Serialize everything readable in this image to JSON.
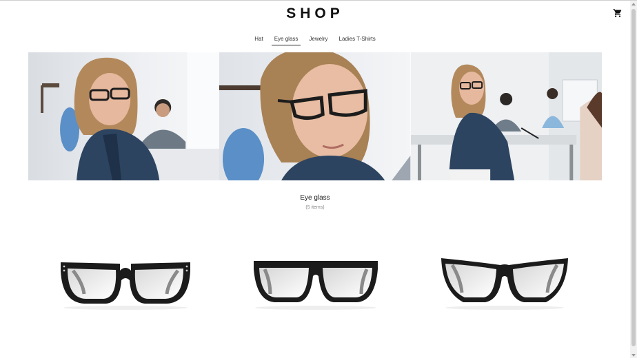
{
  "header": {
    "logo": "SHOP",
    "cart_icon": "shopping-cart-icon"
  },
  "tabs": [
    {
      "label": "Hat",
      "active": false
    },
    {
      "label": "Eye glass",
      "active": true
    },
    {
      "label": "Jewelry",
      "active": false
    },
    {
      "label": "Ladies T-Shirts",
      "active": false
    }
  ],
  "banner": {
    "images": [
      "woman-in-glasses-office-photo",
      "woman-in-glasses-closeup-photo",
      "woman-in-glasses-meeting-photo"
    ]
  },
  "category": {
    "title": "Eye glass",
    "count": "(5 items)"
  },
  "products": [
    {
      "image": "rectangular-studded-glasses"
    },
    {
      "image": "wayfarer-glasses"
    },
    {
      "image": "cat-eye-glasses"
    }
  ],
  "colors": {
    "text": "#222222",
    "muted": "#888888",
    "frame": "#1a1a1a"
  }
}
